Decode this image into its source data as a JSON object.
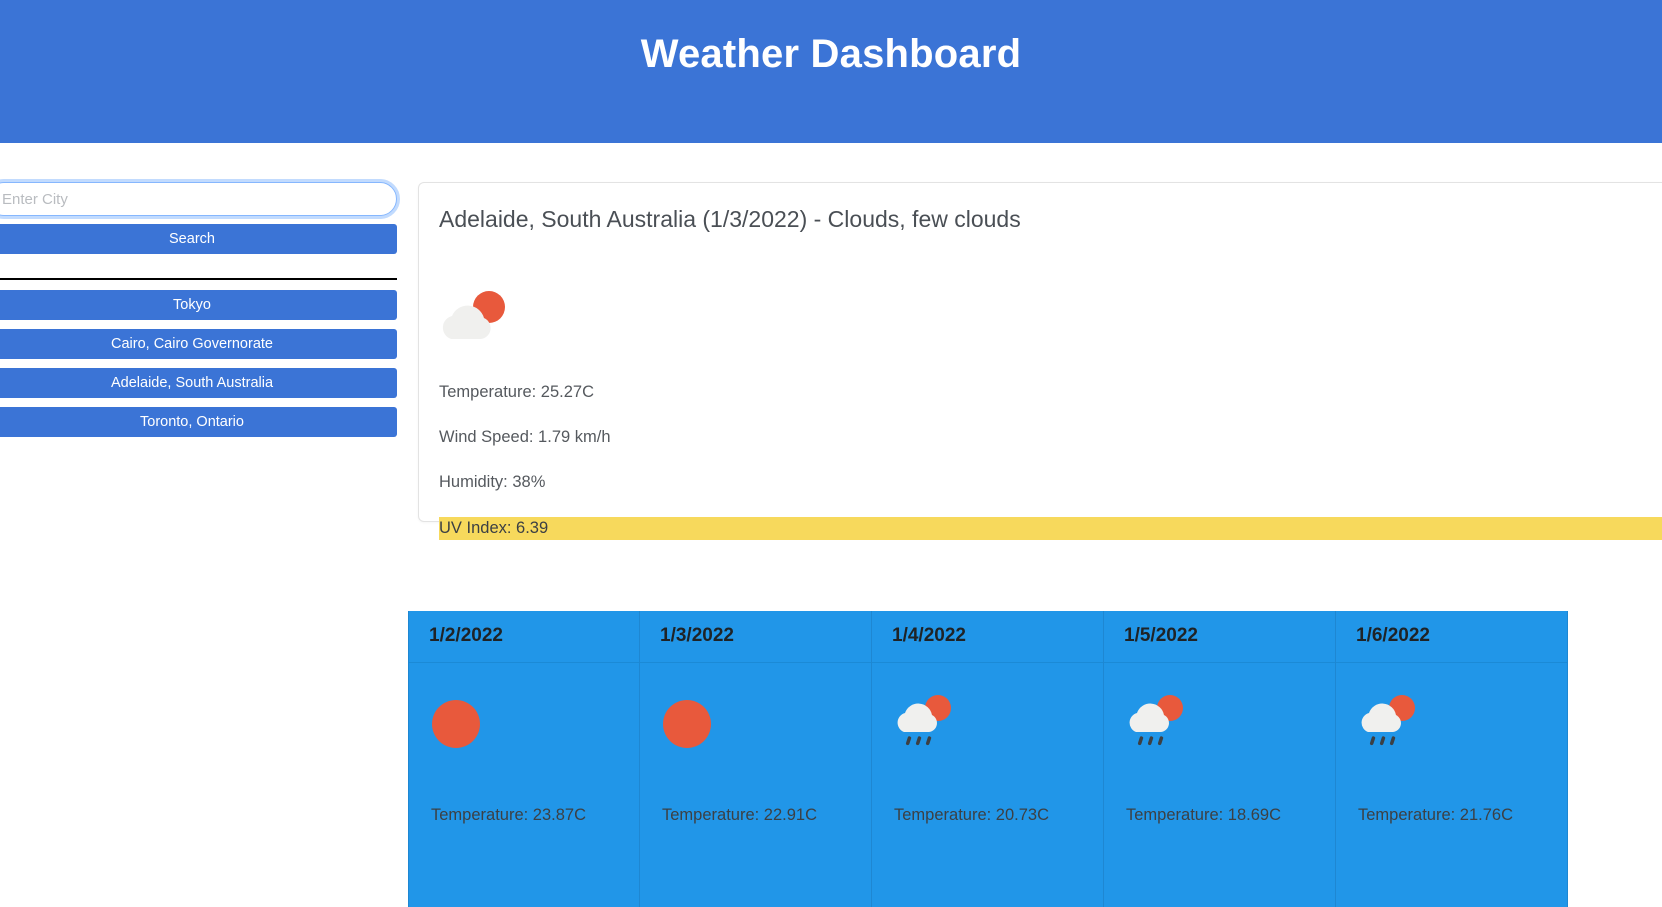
{
  "header": {
    "title": "Weather Dashboard",
    "bg_color": "#3b74d6",
    "text_color": "#ffffff"
  },
  "sidebar": {
    "search": {
      "placeholder": "Enter City",
      "value": "",
      "button_label": "Search"
    },
    "history_items": [
      {
        "label": "Tokyo"
      },
      {
        "label": "Cairo, Cairo Governorate"
      },
      {
        "label": "Adelaide, South Australia"
      },
      {
        "label": "Toronto, Ontario"
      }
    ]
  },
  "current": {
    "title": "Adelaide, South Australia (1/3/2022) - Clouds, few clouds",
    "icon": "sun-behind-cloud-icon",
    "temperature": "Temperature: 25.27C",
    "wind": "Wind Speed: 1.79 km/h",
    "humidity": "Humidity: 38%",
    "uv_index": "UV Index: 6.39",
    "uv_highlight_color": "#f7d95c"
  },
  "forecast": {
    "bg_color": "#2196e8",
    "days": [
      {
        "date": "1/2/2022",
        "icon": "sun-icon",
        "temperature": "Temperature: 23.87C"
      },
      {
        "date": "1/3/2022",
        "icon": "sun-icon",
        "temperature": "Temperature: 22.91C"
      },
      {
        "date": "1/4/2022",
        "icon": "rain-sun-cloud-icon",
        "temperature": "Temperature: 20.73C"
      },
      {
        "date": "1/5/2022",
        "icon": "rain-sun-cloud-icon",
        "temperature": "Temperature: 18.69C"
      },
      {
        "date": "1/6/2022",
        "icon": "rain-sun-cloud-icon",
        "temperature": "Temperature: 21.76C"
      }
    ]
  }
}
